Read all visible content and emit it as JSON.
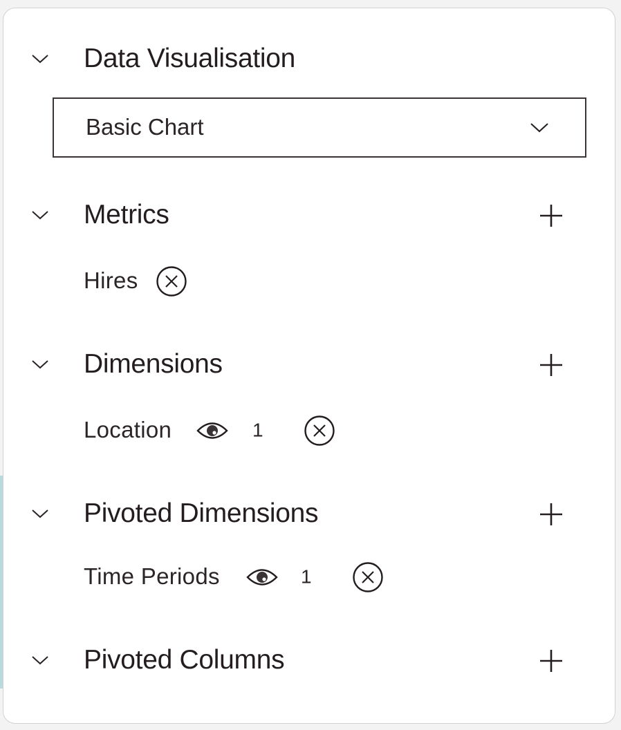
{
  "panel": {
    "sections": [
      {
        "id": "data-visualisation",
        "title": "Data Visualisation",
        "expanded": true,
        "select": {
          "value": "Basic Chart",
          "icon": "chevron-down-icon"
        }
      },
      {
        "id": "metrics",
        "title": "Metrics",
        "expanded": true,
        "add_icon": "plus-icon",
        "items": [
          {
            "label": "Hires",
            "remove_icon": "close-circle-icon"
          }
        ]
      },
      {
        "id": "dimensions",
        "title": "Dimensions",
        "expanded": true,
        "add_icon": "plus-icon",
        "items": [
          {
            "label": "Location",
            "visibility_icon": "eye-icon",
            "count": "1",
            "remove_icon": "close-circle-icon"
          }
        ]
      },
      {
        "id": "pivoted-dimensions",
        "title": "Pivoted Dimensions",
        "expanded": true,
        "add_icon": "plus-icon",
        "items": [
          {
            "label": "Time Periods",
            "visibility_icon": "eye-icon",
            "count": "1",
            "remove_icon": "close-circle-icon"
          }
        ]
      },
      {
        "id": "pivoted-columns",
        "title": "Pivoted Columns",
        "expanded": true,
        "add_icon": "plus-icon",
        "items": []
      }
    ]
  },
  "colors": {
    "text": "#231d1f",
    "border": "#3b3436",
    "background": "#ffffff",
    "page_background": "#f3f3f3",
    "accent_strip": "#b9dbe0"
  }
}
